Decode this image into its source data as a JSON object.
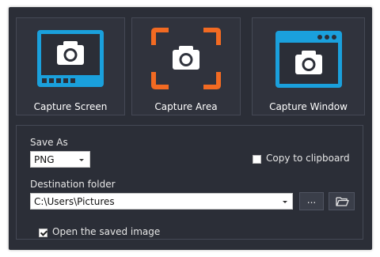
{
  "capture_modes": [
    {
      "label": "Capture Screen",
      "icon": "monitor-camera-icon",
      "accent": "#1aa0dc"
    },
    {
      "label": "Capture Area",
      "icon": "area-camera-icon",
      "accent": "#f26a22"
    },
    {
      "label": "Capture Window",
      "icon": "window-camera-icon",
      "accent": "#1aa0dc"
    }
  ],
  "options": {
    "save_as_label": "Save As",
    "format_value": "PNG",
    "copy_to_clipboard_label": "Copy to clipboard",
    "copy_to_clipboard_checked": false,
    "destination_label": "Destination folder",
    "destination_value": "C:\\Users\\Pictures",
    "browse_label": "...",
    "folder_icon": "folder-open-icon",
    "open_saved_label": "Open the saved image",
    "open_saved_checked": true
  },
  "colors": {
    "background": "#2b2e37",
    "tile": "#30333d",
    "border": "#454955",
    "blue": "#1aa0dc",
    "orange": "#f26a22"
  }
}
